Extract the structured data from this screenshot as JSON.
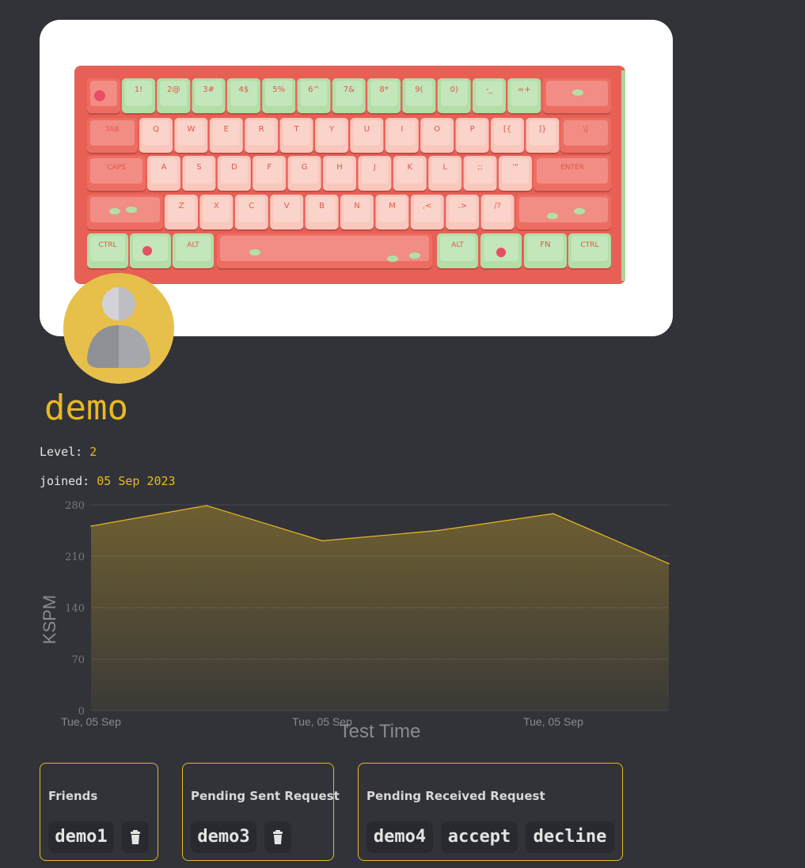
{
  "profile": {
    "username": "demo",
    "level_label": "Level:",
    "level_value": "2",
    "joined_label": "joined:",
    "joined_value": "05 Sep 2023"
  },
  "banner": {
    "image": "keyboard-photo",
    "key_labels": {
      "row1": [
        "",
        "1!",
        "2@",
        "3#",
        "4$",
        "5%",
        "6^",
        "7&",
        "8*",
        "9(",
        "0)",
        "-_",
        "=+",
        ""
      ],
      "row2": [
        "TAB",
        "Q",
        "W",
        "E",
        "R",
        "T",
        "Y",
        "U",
        "I",
        "O",
        "P",
        "[{",
        "]}",
        "\\|"
      ],
      "row3": [
        "CAPS",
        "A",
        "S",
        "D",
        "F",
        "G",
        "H",
        "J",
        "K",
        "L",
        ";:",
        "'\"",
        "ENTER"
      ],
      "row4": [
        "",
        "Z",
        "X",
        "C",
        "V",
        "B",
        "N",
        "M",
        ",<",
        ".>",
        "/?",
        ""
      ],
      "row5": [
        "CTRL",
        "",
        "ALT",
        "",
        "ALT",
        "",
        "FN",
        "CTRL"
      ]
    }
  },
  "avatar": {
    "icon": "user-silhouette-icon"
  },
  "chart_data": {
    "type": "area",
    "x": [
      "Tue, 05 Sep",
      "",
      "Tue, 05 Sep",
      "",
      "Tue, 05 Sep",
      ""
    ],
    "x_tick_labels": [
      "Tue, 05 Sep",
      "Tue, 05 Sep",
      "Tue, 05 Sep"
    ],
    "values": [
      251,
      279,
      231,
      245,
      268,
      200
    ],
    "ylabel": "KSPM",
    "xlabel": "Test Time",
    "ylim": [
      0,
      280
    ],
    "y_ticks": [
      0,
      70,
      140,
      210,
      280
    ],
    "grid": true,
    "line_color": "#e8b923"
  },
  "friends": {
    "title": "Friends",
    "items": [
      "demo1"
    ],
    "delete_icon": "trash-icon"
  },
  "pending_sent": {
    "title": "Pending Sent Request",
    "items": [
      "demo3"
    ],
    "delete_icon": "trash-icon"
  },
  "pending_received": {
    "title": "Pending Received Request",
    "items": [
      "demo4"
    ],
    "accept_label": "accept",
    "decline_label": "decline"
  }
}
